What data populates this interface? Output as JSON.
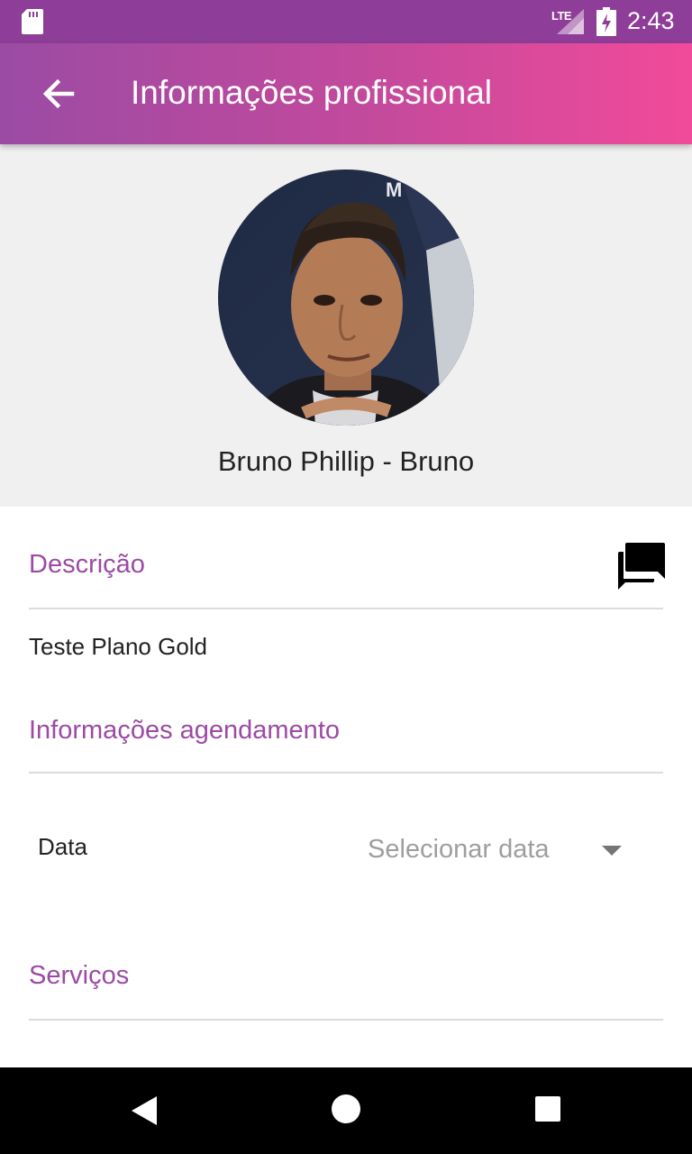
{
  "status_bar": {
    "network": "LTE",
    "time": "2:43"
  },
  "app_bar": {
    "title": "Informações profissional",
    "back_icon": "arrow-back-icon"
  },
  "profile": {
    "name": "Bruno Phillip - Bruno"
  },
  "sections": {
    "description": {
      "title": "Descrição",
      "text": "Teste Plano Gold",
      "action_icon": "chat-bubble-icon"
    },
    "scheduling": {
      "title": "Informações agendamento",
      "date_label": "Data",
      "date_placeholder": "Selecionar data"
    },
    "services": {
      "title": "Serviços"
    }
  },
  "colors": {
    "accent": "#9c4aa4",
    "status_bar": "#8e3e98",
    "gradient_start": "#9b4ba4",
    "gradient_end": "#f24a9a"
  }
}
